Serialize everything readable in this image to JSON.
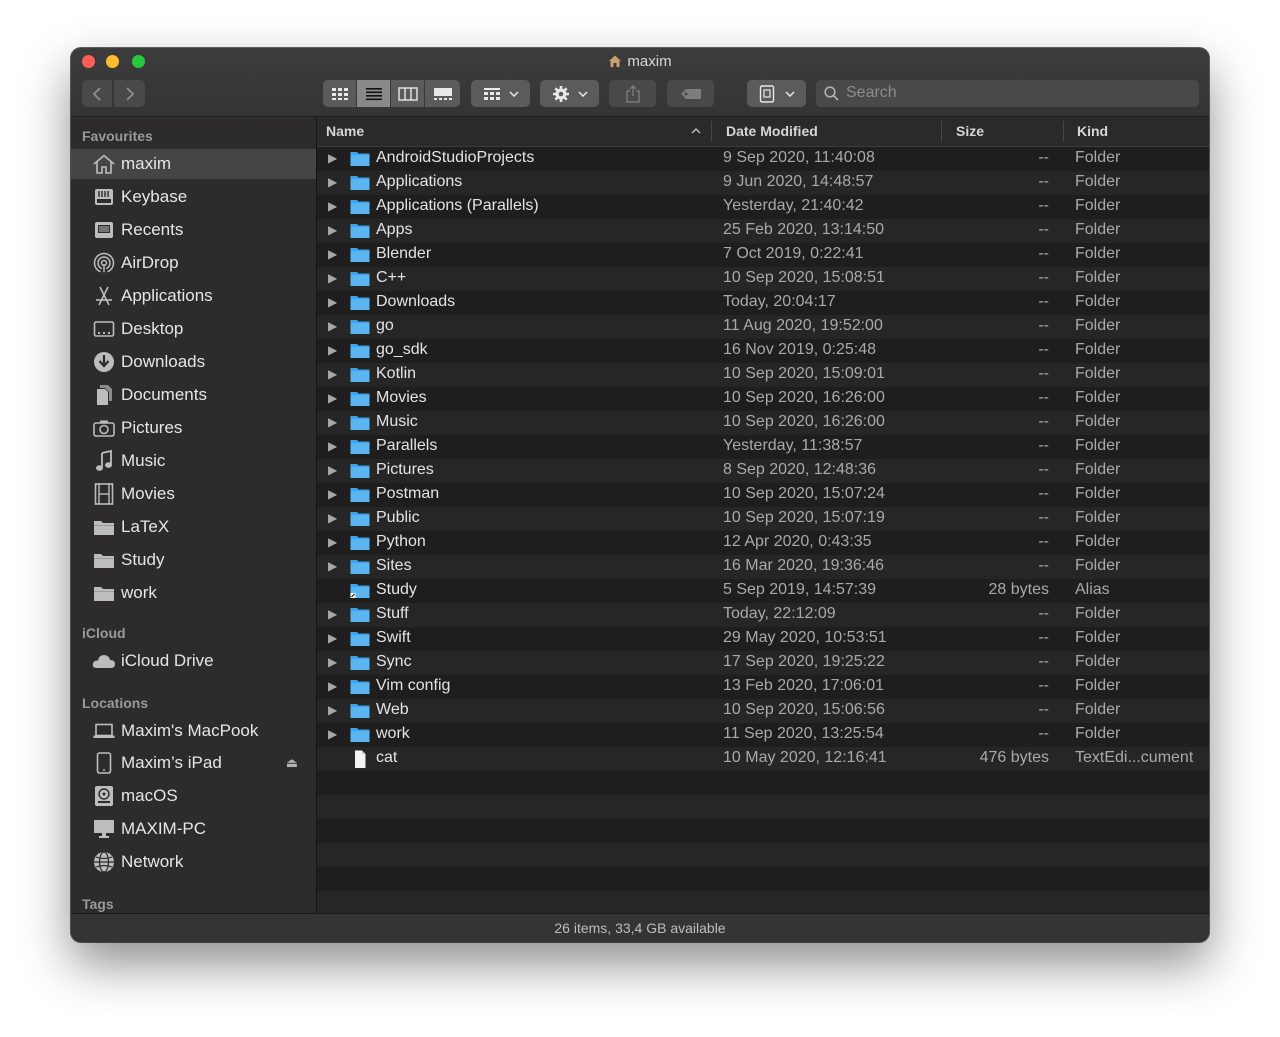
{
  "window": {
    "title": "maxim"
  },
  "search": {
    "placeholder": "Search"
  },
  "sidebar": {
    "favourites_header": "Favourites",
    "favourites": [
      {
        "label": "maxim",
        "icon": "home-icon"
      },
      {
        "label": "Keybase",
        "icon": "drive-icon"
      },
      {
        "label": "Recents",
        "icon": "recents-icon"
      },
      {
        "label": "AirDrop",
        "icon": "airdrop-icon"
      },
      {
        "label": "Applications",
        "icon": "applications-icon"
      },
      {
        "label": "Desktop",
        "icon": "desktop-icon"
      },
      {
        "label": "Downloads",
        "icon": "downloads-icon"
      },
      {
        "label": "Documents",
        "icon": "document-icon"
      },
      {
        "label": "Pictures",
        "icon": "camera-icon"
      },
      {
        "label": "Music",
        "icon": "music-note-icon"
      },
      {
        "label": "Movies",
        "icon": "film-icon"
      },
      {
        "label": "LaTeX",
        "icon": "folder-icon"
      },
      {
        "label": "Study",
        "icon": "folder-icon"
      },
      {
        "label": "work",
        "icon": "folder-icon"
      }
    ],
    "icloud_header": "iCloud",
    "icloud": [
      {
        "label": "iCloud Drive",
        "icon": "cloud-icon"
      }
    ],
    "locations_header": "Locations",
    "locations": [
      {
        "label": "Maxim's MacPook",
        "icon": "laptop-icon"
      },
      {
        "label": "Maxim’s iPad",
        "icon": "ipad-icon"
      },
      {
        "label": "macOS",
        "icon": "disk-icon"
      },
      {
        "label": "MAXIM-PC",
        "icon": "monitor-icon"
      },
      {
        "label": "Network",
        "icon": "network-icon"
      }
    ],
    "tags_header": "Tags"
  },
  "columns": {
    "name": "Name",
    "date": "Date Modified",
    "size": "Size",
    "kind": "Kind"
  },
  "files": [
    {
      "name": "AndroidStudioProjects",
      "date": "9 Sep 2020, 11:40:08",
      "size": "--",
      "kind": "Folder",
      "type": "folder"
    },
    {
      "name": "Applications",
      "date": "9 Jun 2020, 14:48:57",
      "size": "--",
      "kind": "Folder",
      "type": "folder"
    },
    {
      "name": "Applications (Parallels)",
      "date": "Yesterday, 21:40:42",
      "size": "--",
      "kind": "Folder",
      "type": "folder"
    },
    {
      "name": "Apps",
      "date": "25 Feb 2020, 13:14:50",
      "size": "--",
      "kind": "Folder",
      "type": "folder"
    },
    {
      "name": "Blender",
      "date": "7 Oct 2019, 0:22:41",
      "size": "--",
      "kind": "Folder",
      "type": "folder"
    },
    {
      "name": "C++",
      "date": "10 Sep 2020, 15:08:51",
      "size": "--",
      "kind": "Folder",
      "type": "folder"
    },
    {
      "name": "Downloads",
      "date": "Today, 20:04:17",
      "size": "--",
      "kind": "Folder",
      "type": "folder"
    },
    {
      "name": "go",
      "date": "11 Aug 2020, 19:52:00",
      "size": "--",
      "kind": "Folder",
      "type": "folder"
    },
    {
      "name": "go_sdk",
      "date": "16 Nov 2019, 0:25:48",
      "size": "--",
      "kind": "Folder",
      "type": "folder"
    },
    {
      "name": "Kotlin",
      "date": "10 Sep 2020, 15:09:01",
      "size": "--",
      "kind": "Folder",
      "type": "folder"
    },
    {
      "name": "Movies",
      "date": "10 Sep 2020, 16:26:00",
      "size": "--",
      "kind": "Folder",
      "type": "folder"
    },
    {
      "name": "Music",
      "date": "10 Sep 2020, 16:26:00",
      "size": "--",
      "kind": "Folder",
      "type": "folder"
    },
    {
      "name": "Parallels",
      "date": "Yesterday, 11:38:57",
      "size": "--",
      "kind": "Folder",
      "type": "folder"
    },
    {
      "name": "Pictures",
      "date": "8 Sep 2020, 12:48:36",
      "size": "--",
      "kind": "Folder",
      "type": "folder"
    },
    {
      "name": "Postman",
      "date": "10 Sep 2020, 15:07:24",
      "size": "--",
      "kind": "Folder",
      "type": "folder"
    },
    {
      "name": "Public",
      "date": "10 Sep 2020, 15:07:19",
      "size": "--",
      "kind": "Folder",
      "type": "folder"
    },
    {
      "name": "Python",
      "date": "12 Apr 2020, 0:43:35",
      "size": "--",
      "kind": "Folder",
      "type": "folder"
    },
    {
      "name": "Sites",
      "date": "16 Mar 2020, 19:36:46",
      "size": "--",
      "kind": "Folder",
      "type": "folder"
    },
    {
      "name": "Study",
      "date": "5 Sep 2019, 14:57:39",
      "size": "28 bytes",
      "kind": "Alias",
      "type": "alias"
    },
    {
      "name": "Stuff",
      "date": "Today, 22:12:09",
      "size": "--",
      "kind": "Folder",
      "type": "folder"
    },
    {
      "name": "Swift",
      "date": "29 May 2020, 10:53:51",
      "size": "--",
      "kind": "Folder",
      "type": "folder"
    },
    {
      "name": "Sync",
      "date": "17 Sep 2020, 19:25:22",
      "size": "--",
      "kind": "Folder",
      "type": "folder"
    },
    {
      "name": "Vim config",
      "date": "13 Feb 2020, 17:06:01",
      "size": "--",
      "kind": "Folder",
      "type": "folder"
    },
    {
      "name": "Web",
      "date": "10 Sep 2020, 15:06:56",
      "size": "--",
      "kind": "Folder",
      "type": "folder"
    },
    {
      "name": "work",
      "date": "11 Sep 2020, 13:25:54",
      "size": "--",
      "kind": "Folder",
      "type": "folder"
    },
    {
      "name": "cat",
      "date": "10 May 2020, 12:16:41",
      "size": "476 bytes",
      "kind": "TextEdi...cument",
      "type": "document"
    }
  ],
  "status": {
    "text": "26 items, 33,4 GB available"
  },
  "colors": {
    "folder": "#3ea3e8",
    "window_bg": "#1e1e1e",
    "sidebar_bg": "#2d2b2c"
  }
}
